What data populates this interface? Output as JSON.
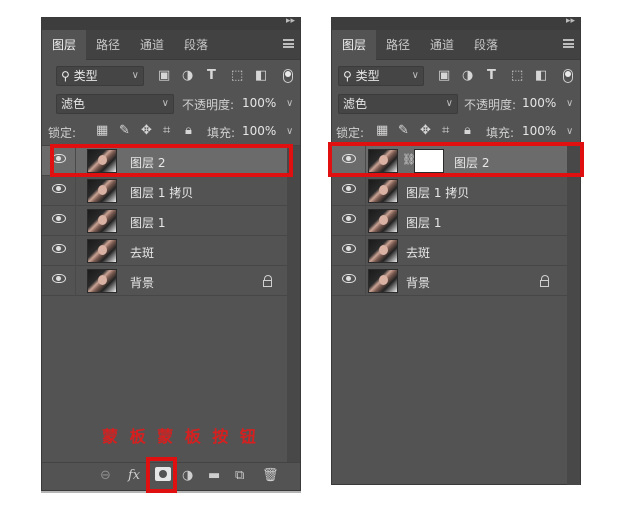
{
  "left_panel": {
    "tabs": [
      "图层",
      "路径",
      "通道",
      "段落"
    ],
    "filter_kind": "类型",
    "blend_mode": "滤色",
    "opacity_label": "不透明度:",
    "opacity_value": "100%",
    "lock_label": "锁定:",
    "fill_label": "填充:",
    "fill_value": "100%",
    "layers": [
      {
        "name": "图层 2",
        "selected": true
      },
      {
        "name": "图层 1 拷贝"
      },
      {
        "name": "图层 1"
      },
      {
        "name": "去斑"
      },
      {
        "name": "背景",
        "locked": true
      }
    ],
    "caption": "蒙 板 蒙 板 按 钮",
    "bottom_icons": [
      "link-icon",
      "fx-icon",
      "add-mask-icon",
      "adjustment-icon",
      "folder-icon",
      "new-layer-icon",
      "trash-icon"
    ]
  },
  "right_panel": {
    "tabs": [
      "图层",
      "路径",
      "通道",
      "段落"
    ],
    "filter_kind": "类型",
    "blend_mode": "滤色",
    "opacity_label": "不透明度:",
    "opacity_value": "100%",
    "lock_label": "锁定:",
    "fill_label": "填充:",
    "fill_value": "100%",
    "layers": [
      {
        "name": "图层 2",
        "selected": true,
        "has_mask": true
      },
      {
        "name": "图层 1 拷贝"
      },
      {
        "name": "图层 1"
      },
      {
        "name": "去斑"
      },
      {
        "name": "背景",
        "locked": true
      }
    ]
  },
  "colors": {
    "panel_bg": "#535353",
    "highlight_red": "#e01010",
    "selected_row": "#6b6b6b"
  }
}
